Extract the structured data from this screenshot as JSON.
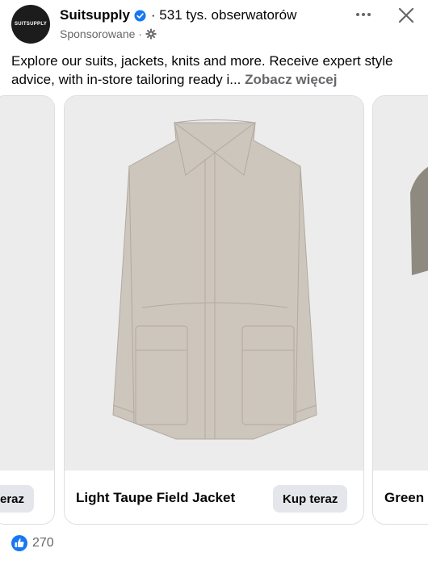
{
  "post": {
    "avatar_text": "SUITSUPPLY",
    "page_name": "Suitsupply",
    "followers": "· 531 tys. obserwatorów",
    "sponsored": "Sponsorowane ·",
    "caption": "Explore our suits, jackets, knits and more. Receive expert style advice, with in-store tailoring ready i...",
    "see_more": "Zobacz więcej"
  },
  "carousel": {
    "cards": [
      {
        "title": "",
        "cta": "teraz"
      },
      {
        "title": "Light Taupe Field Jacket",
        "cta": "Kup teraz"
      },
      {
        "title": "Green",
        "cta": ""
      }
    ]
  },
  "reactions": {
    "count": "270"
  },
  "colors": {
    "verified": "#1877f2",
    "like": "#1877f2",
    "product": "#cdc6bd"
  }
}
